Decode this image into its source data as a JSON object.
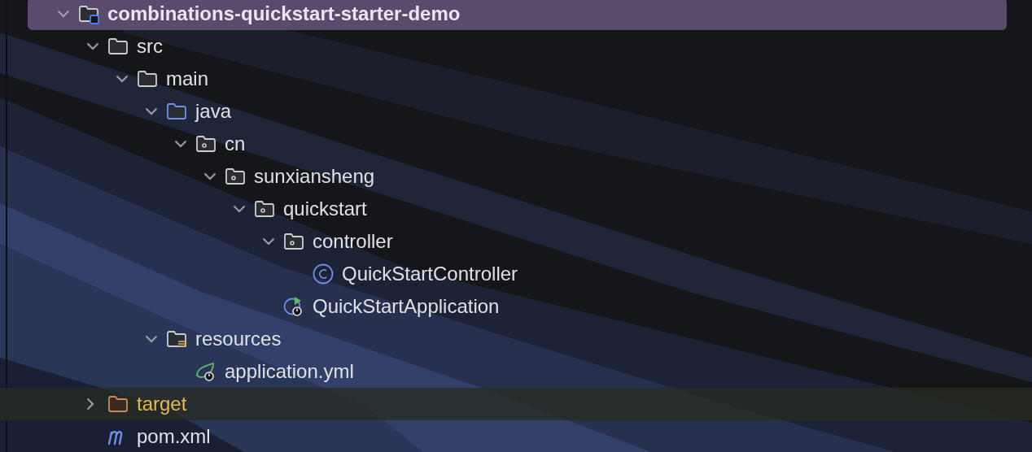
{
  "project_tree": [
    {
      "label": "combinations-quickstart-starter-demo",
      "kind": "module",
      "expanded": true,
      "selected": true,
      "hovered": false,
      "children": [
        {
          "label": "src",
          "kind": "folder",
          "expanded": true,
          "selected": false,
          "hovered": false,
          "children": [
            {
              "label": "main",
              "kind": "folder",
              "expanded": true,
              "selected": false,
              "hovered": false,
              "children": [
                {
                  "label": "java",
                  "kind": "source-folder",
                  "expanded": true,
                  "selected": false,
                  "hovered": false,
                  "children": [
                    {
                      "label": "cn",
                      "kind": "package",
                      "expanded": true,
                      "selected": false,
                      "hovered": false,
                      "children": [
                        {
                          "label": "sunxiansheng",
                          "kind": "package",
                          "expanded": true,
                          "selected": false,
                          "hovered": false,
                          "children": [
                            {
                              "label": "quickstart",
                              "kind": "package",
                              "expanded": true,
                              "selected": false,
                              "hovered": false,
                              "children": [
                                {
                                  "label": "controller",
                                  "kind": "package",
                                  "expanded": true,
                                  "selected": false,
                                  "hovered": false,
                                  "children": [
                                    {
                                      "label": "QuickStartController",
                                      "kind": "class",
                                      "selected": false,
                                      "hovered": false
                                    }
                                  ]
                                },
                                {
                                  "label": "QuickStartApplication",
                                  "kind": "spring-app",
                                  "selected": false,
                                  "hovered": false
                                }
                              ]
                            }
                          ]
                        }
                      ]
                    }
                  ]
                },
                {
                  "label": "resources",
                  "kind": "resources-folder",
                  "expanded": true,
                  "selected": false,
                  "hovered": false,
                  "children": [
                    {
                      "label": "application.yml",
                      "kind": "spring-config",
                      "selected": false,
                      "hovered": false
                    }
                  ]
                }
              ]
            }
          ]
        },
        {
          "label": "target",
          "kind": "excluded-folder",
          "expanded": false,
          "selected": false,
          "hovered": true
        },
        {
          "label": "pom.xml",
          "kind": "maven",
          "selected": false,
          "hovered": false
        }
      ]
    }
  ]
}
